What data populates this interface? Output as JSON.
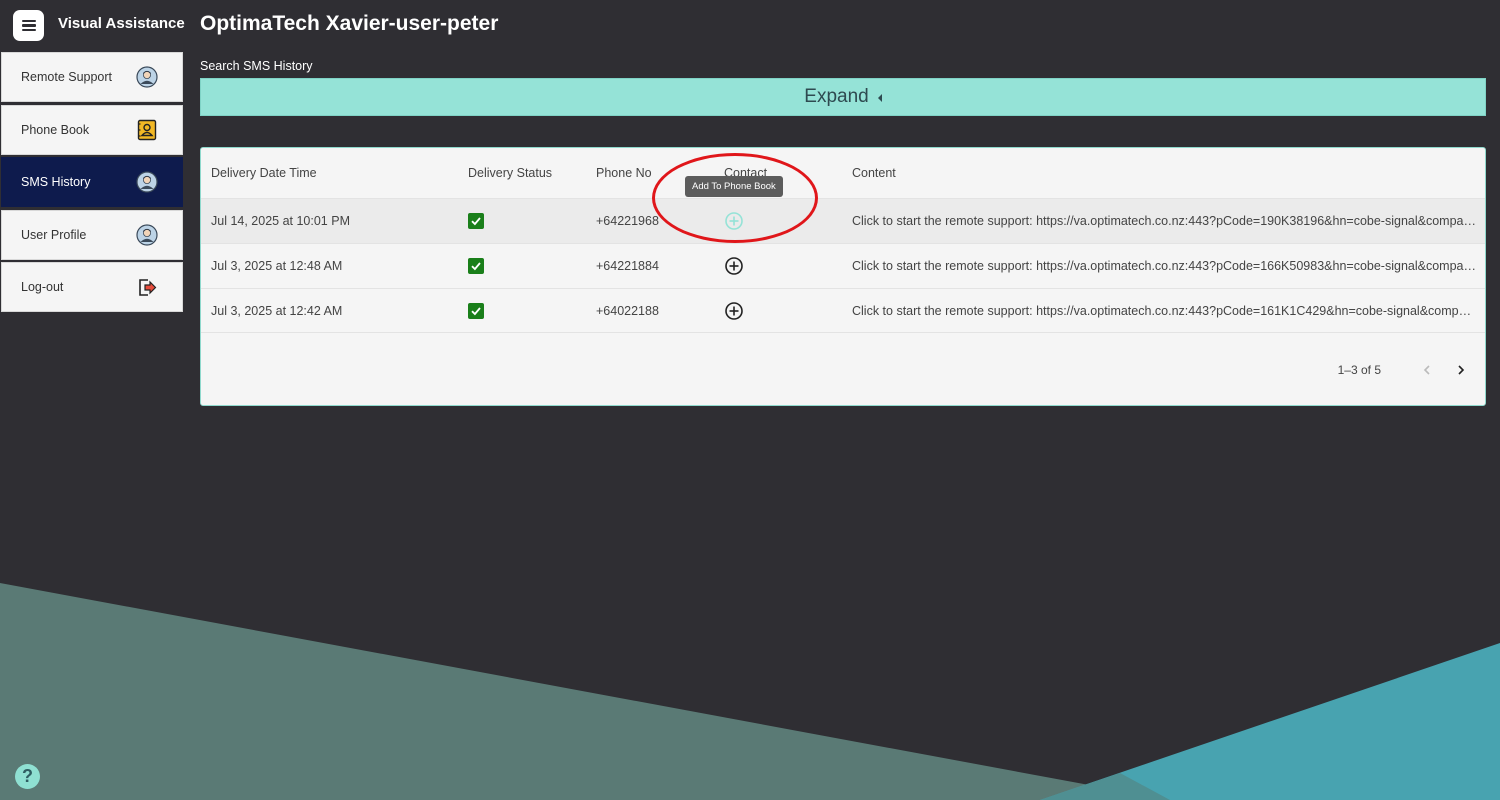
{
  "app": {
    "name": "Visual Assistance",
    "title": "OptimaTech Xavier-user-peter"
  },
  "sidebar": {
    "items": [
      {
        "label": "Remote Support",
        "icon": "user-avatar-icon",
        "active": false
      },
      {
        "label": "Phone Book",
        "icon": "address-book-icon",
        "active": false
      },
      {
        "label": "SMS History",
        "icon": "user-avatar-icon",
        "active": true
      },
      {
        "label": "User Profile",
        "icon": "user-avatar-icon",
        "active": false
      },
      {
        "label": "Log-out",
        "icon": "logout-icon",
        "active": false
      }
    ]
  },
  "search": {
    "label": "Search SMS History",
    "expand_label": "Expand"
  },
  "table": {
    "headers": [
      "Delivery Date Time",
      "Delivery Status",
      "Phone No",
      "Contact",
      "Content"
    ],
    "rows": [
      {
        "date": "Jul 14, 2025 at 10:01 PM",
        "delivered": true,
        "phone": "+64221968",
        "content": "Click to start the remote support: https://va.optimatech.co.nz:443?pCode=190K38196&hn=cobe-signal&company…"
      },
      {
        "date": "Jul 3, 2025 at 12:48 AM",
        "delivered": true,
        "phone": "+64221884",
        "content": "Click to start the remote support: https://va.optimatech.co.nz:443?pCode=166K50983&hn=cobe-signal&company…"
      },
      {
        "date": "Jul 3, 2025 at 12:42 AM",
        "delivered": true,
        "phone": "+64022188",
        "content": "Click to start the remote support: https://va.optimatech.co.nz:443?pCode=161K1C429&hn=cobe-signal&company…"
      }
    ],
    "tooltip": "Add To Phone Book",
    "pagination": {
      "range": "1–3 of 5"
    }
  },
  "help": {
    "symbol": "?"
  },
  "colors": {
    "background": "#2f2e33",
    "accent": "#95e3d7",
    "sidebar_active": "#0e1b4d",
    "check": "#1a7f1a",
    "annotation": "#e0161a"
  }
}
